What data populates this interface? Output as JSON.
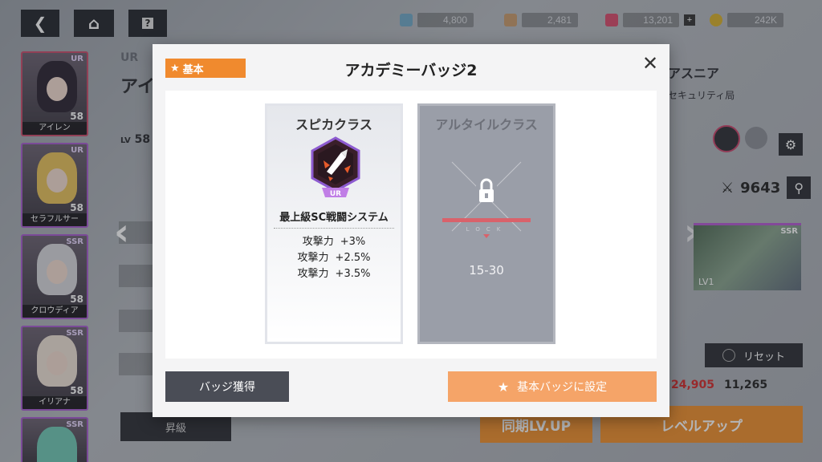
{
  "topbar": {
    "back_icon": "chevron-left-icon",
    "home_icon": "home-icon",
    "help_icon": "question-icon",
    "resources": [
      {
        "name": "stamina",
        "value": "4,800",
        "color": "#6fa8c7"
      },
      {
        "name": "ticket",
        "value": "2,481",
        "color": "#c89a6a"
      },
      {
        "name": "gem",
        "value": "13,201",
        "color": "#d94a6a"
      },
      {
        "name": "gold",
        "value": "242K",
        "color": "#d8b02a"
      }
    ]
  },
  "roster": [
    {
      "name": "アイレン",
      "rarity": "UR",
      "level": "58"
    },
    {
      "name": "セラフルサー",
      "rarity": "UR",
      "level": "58"
    },
    {
      "name": "クロウディア",
      "rarity": "SSR",
      "level": "58"
    },
    {
      "name": "イリアナ",
      "rarity": "SSR",
      "level": "58"
    },
    {
      "name": "",
      "rarity": "SSR",
      "level": ""
    }
  ],
  "background": {
    "char_rarity": "UR",
    "char_name_partial": "アイ",
    "level_prefix": "LV",
    "level": "58",
    "right_name": "アスニア",
    "right_sub": "セキュリティ局",
    "power": "9643",
    "thumb_rarity": "SSR",
    "thumb_level": "LV1",
    "reset_label": "リセット",
    "cost_red": "24,905",
    "cost_dark": "11,265",
    "sync_label": "同期LV.UP",
    "levelup_label": "レベルアップ",
    "ascend_label": "昇級"
  },
  "modal": {
    "tag_label": "基本",
    "title": "アカデミーバッジ2",
    "close_icon": "close-icon",
    "badges": [
      {
        "class_name": "スピカクラス",
        "rarity": "UR",
        "badge_name": "最上級SC戦闘システム",
        "stats": [
          {
            "label": "攻撃力",
            "value": "+3%"
          },
          {
            "label": "攻撃力",
            "value": "+2.5%"
          },
          {
            "label": "攻撃力",
            "value": "+3.5%"
          }
        ]
      },
      {
        "class_name": "アルタイルクラス",
        "lock_text": "LOCK",
        "range": "15-30"
      }
    ],
    "get_button": "バッジ獲得",
    "set_button": "基本バッジに設定"
  }
}
